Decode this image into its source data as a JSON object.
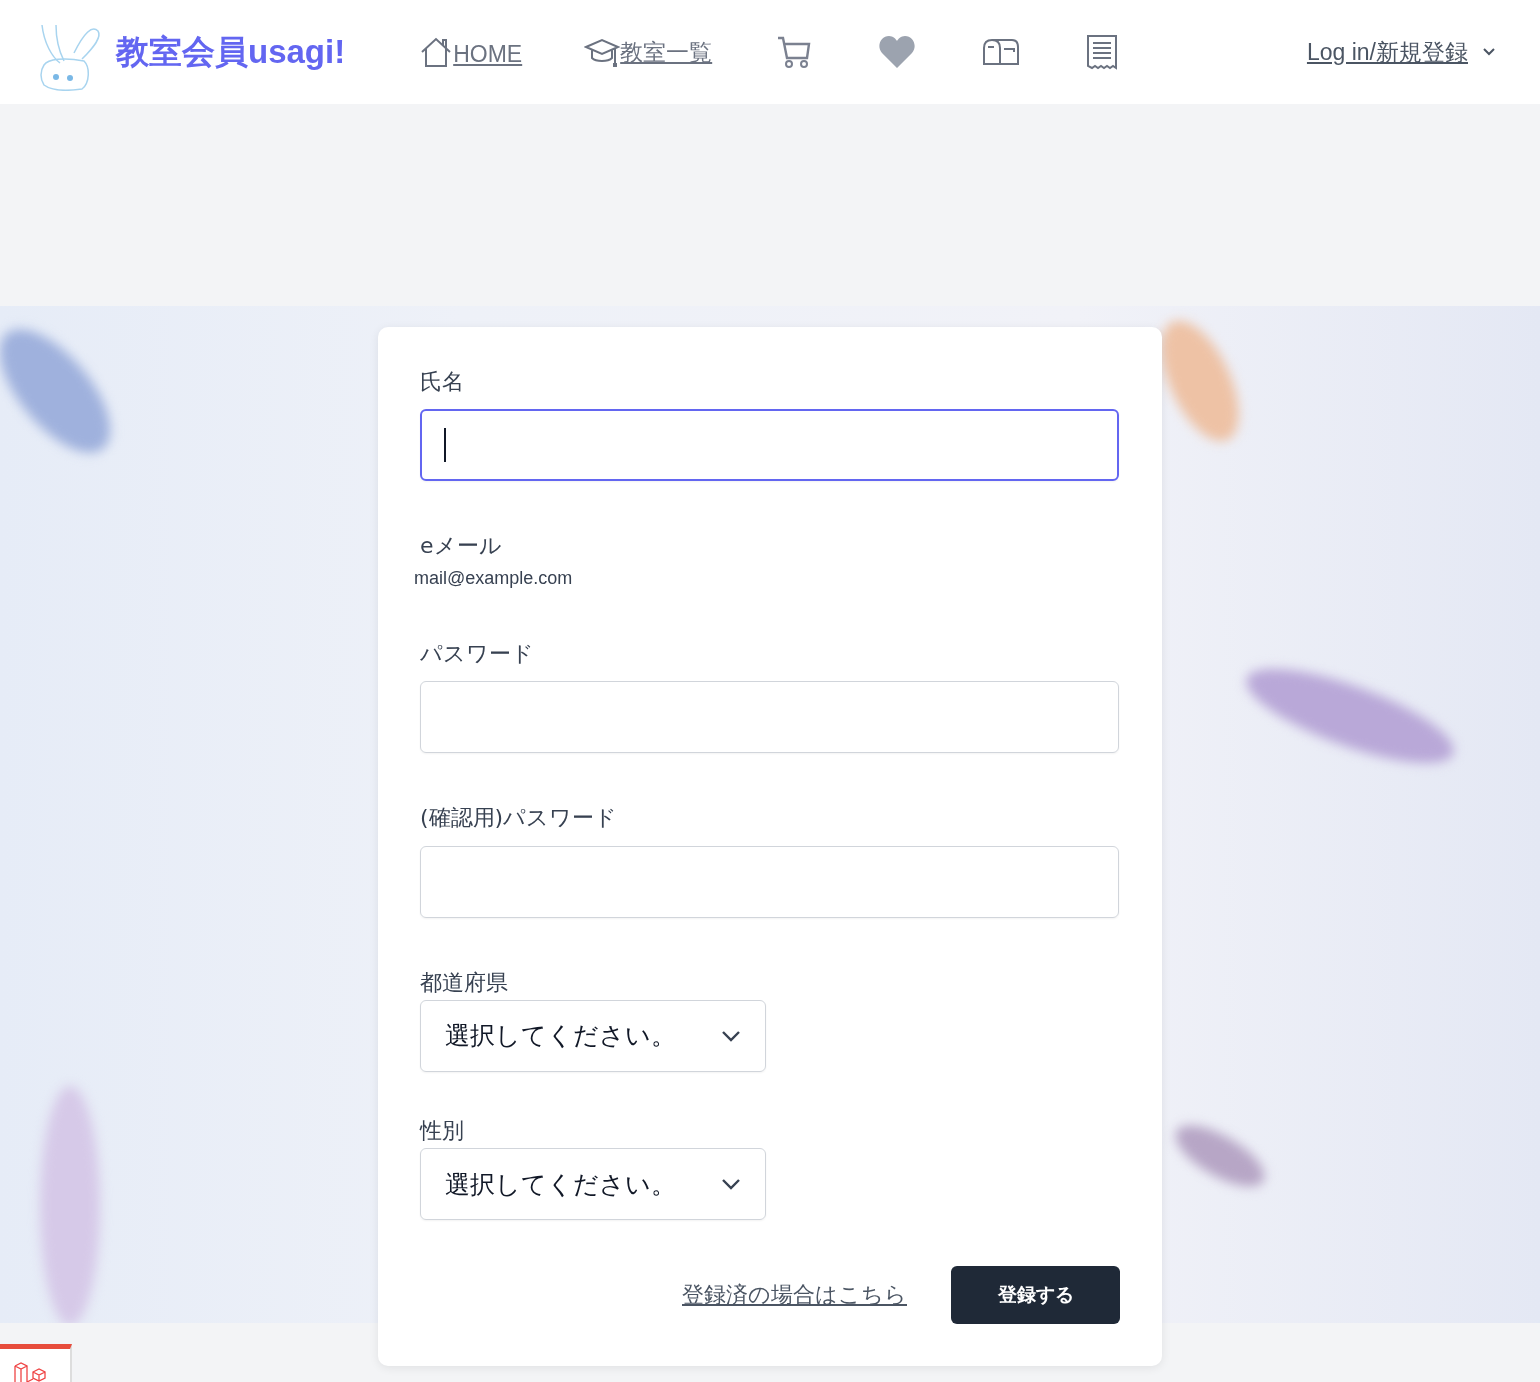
{
  "header": {
    "brand": "教室会員usagi!",
    "nav": [
      {
        "label": "HOME"
      },
      {
        "label": "教室一覧"
      }
    ],
    "account": "Log in/新規登録"
  },
  "form": {
    "fields": [
      {
        "kind": "input",
        "label": "氏名",
        "focused": true
      },
      {
        "kind": "static",
        "label": "eメール",
        "value": "mail@example.com"
      },
      {
        "kind": "input",
        "label": "パスワード",
        "focused": false
      },
      {
        "kind": "input",
        "label": "(確認用)パスワード",
        "focused": false
      },
      {
        "kind": "select",
        "label": "都道府県",
        "value": "選択してください。"
      },
      {
        "kind": "select",
        "label": "性別",
        "value": "選択してください。"
      }
    ],
    "login_link": "登録済の場合はこちら",
    "submit": "登録する"
  }
}
